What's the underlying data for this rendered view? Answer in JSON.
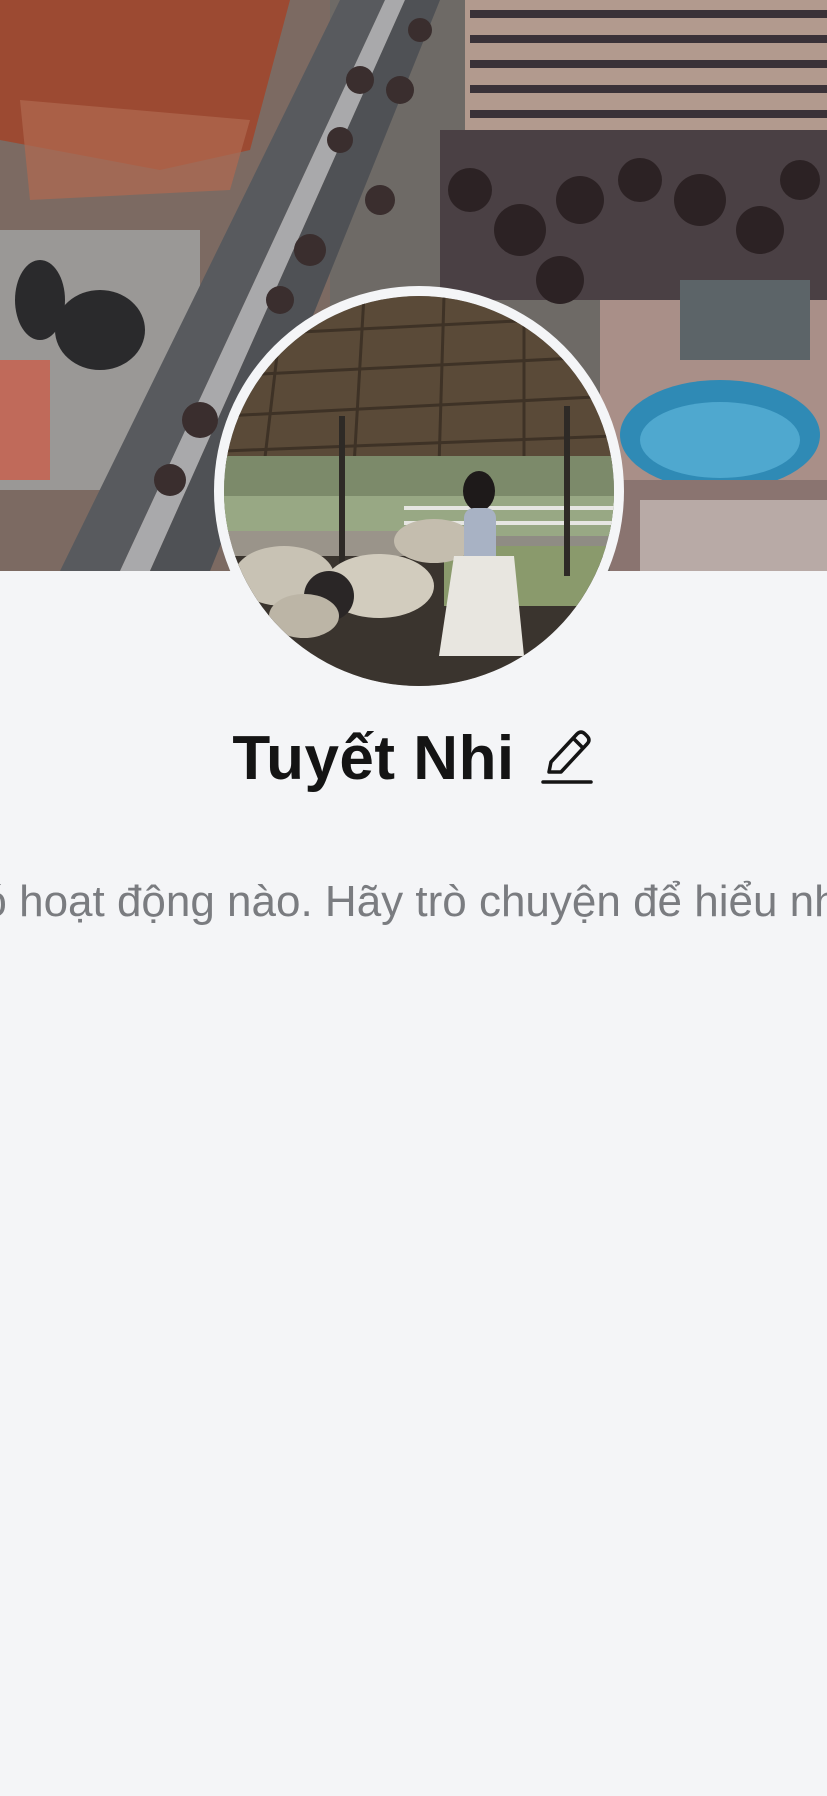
{
  "profile": {
    "name": "Tuyết Nhi",
    "edit_icon": "pencil-icon",
    "activity_text": "Chưa có hoạt động nào. Hãy trò chuyện để hiểu nhau hơn!"
  },
  "colors": {
    "background": "#f4f5f7",
    "name_text": "#141414",
    "secondary_text": "#7a7c80"
  },
  "icons": {
    "cover": "cover-photo-aerial-resort",
    "avatar": "avatar-photo-sheep-farm"
  }
}
